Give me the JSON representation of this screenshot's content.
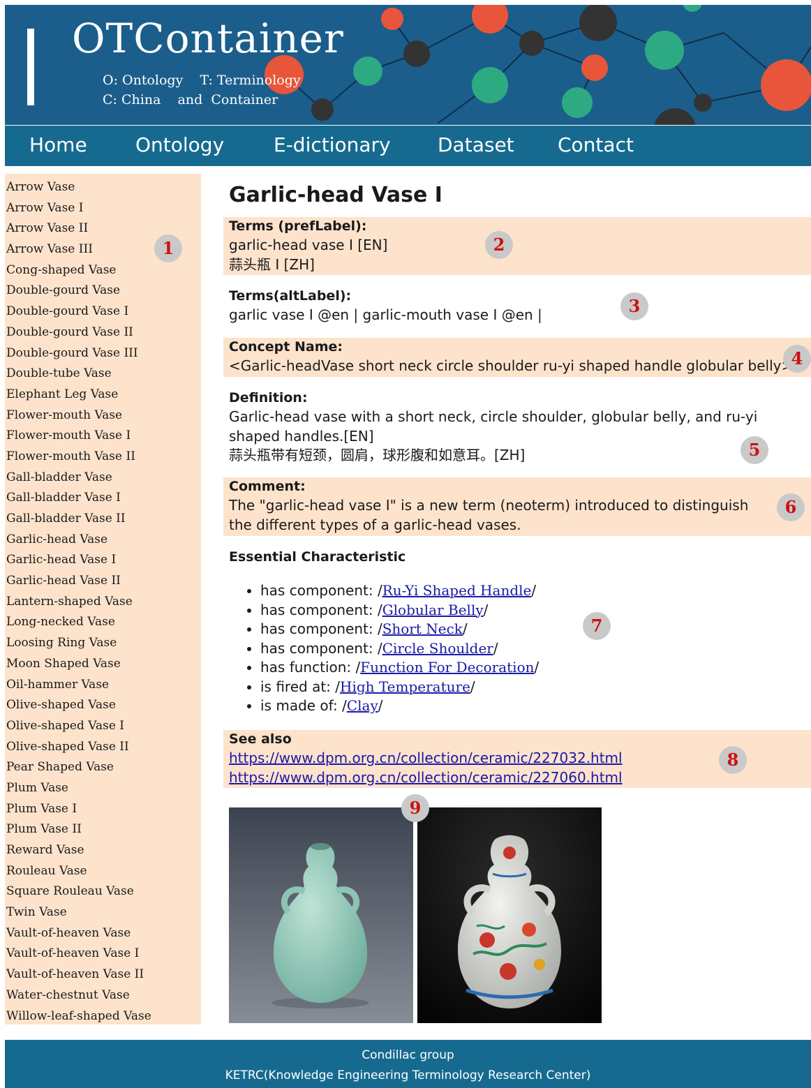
{
  "header": {
    "title": "OTContainer",
    "subtitle_line1": "O: Ontology    T: Terminology",
    "subtitle_line2": "C: China    and  Container",
    "colors": {
      "banner": "#1b5e8c",
      "node_red": "#e8553a",
      "node_green": "#2eaa83",
      "node_dark": "#333333"
    }
  },
  "nav": {
    "items": [
      "Home",
      "Ontology",
      "E-dictionary",
      "Dataset",
      "Contact"
    ],
    "color": "#176a8f"
  },
  "sidebar": {
    "items": [
      "Arrow Vase",
      "Arrow Vase I",
      "Arrow Vase II",
      "Arrow Vase III",
      "Cong-shaped Vase",
      "Double-gourd Vase",
      "Double-gourd Vase I",
      "Double-gourd Vase II",
      "Double-gourd Vase III",
      "Double-tube Vase",
      "Elephant Leg Vase",
      "Flower-mouth Vase",
      "Flower-mouth Vase I",
      "Flower-mouth Vase II",
      "Gall-bladder Vase",
      "Gall-bladder Vase I",
      "Gall-bladder Vase II",
      "Garlic-head Vase",
      "Garlic-head Vase I",
      "Garlic-head Vase II",
      "Lantern-shaped Vase",
      "Long-necked Vase",
      "Loosing Ring Vase",
      "Moon Shaped Vase",
      "Oil-hammer Vase",
      "Olive-shaped Vase",
      "Olive-shaped Vase I",
      "Olive-shaped Vase II",
      "Pear Shaped Vase",
      "Plum Vase",
      "Plum Vase I",
      "Plum Vase II",
      "Reward Vase",
      "Rouleau Vase",
      "Square Rouleau Vase",
      "Twin Vase",
      "Vault-of-heaven Vase",
      "Vault-of-heaven Vase I",
      "Vault-of-heaven Vase II",
      "Water-chestnut Vase",
      "Willow-leaf-shaped Vase"
    ],
    "color": "#fde3cc"
  },
  "markers": [
    "1",
    "2",
    "3",
    "4",
    "5",
    "6",
    "7",
    "8",
    "9"
  ],
  "main": {
    "title": "Garlic-head Vase I",
    "pref_label": {
      "label": "Terms (prefLabel):",
      "en": "garlic-head vase I [EN]",
      "zh": "蒜头瓶 I [ZH]"
    },
    "alt_label": {
      "label": "Terms(altLabel):",
      "value": "garlic vase I @en | garlic-mouth vase I @en |"
    },
    "concept": {
      "label": "Concept Name:",
      "value": "<Garlic-headVase short neck circle shoulder ru-yi shaped handle globular belly>"
    },
    "definition": {
      "label": "Definition:",
      "en": "Garlic-head vase with a short neck, circle shoulder, globular belly, and ru-yi shaped handles.[EN]",
      "zh": "蒜头瓶带有短颈，圆肩，球形腹和如意耳。[ZH]"
    },
    "comment": {
      "label": "Comment:",
      "value": "The \"garlic-head vase I\" is a new term (neoterm) introduced to distinguish the different types of a garlic-head vases."
    },
    "essential": {
      "label": "Essential Characteristic",
      "items": [
        {
          "prefix": "has component: /",
          "link": "Ru-Yi Shaped Handle",
          "suffix": "/"
        },
        {
          "prefix": "has component: /",
          "link": "Globular Belly",
          "suffix": "/"
        },
        {
          "prefix": "has component: /",
          "link": "Short Neck",
          "suffix": "/"
        },
        {
          "prefix": "has component: /",
          "link": "Circle Shoulder",
          "suffix": "/"
        },
        {
          "prefix": "has function: /",
          "link": "Function For Decoration",
          "suffix": "/"
        },
        {
          "prefix": "is fired at: /",
          "link": "High Temperature",
          "suffix": "/"
        },
        {
          "prefix": "is made of: /",
          "link": "Clay",
          "suffix": "/"
        }
      ]
    },
    "see_also": {
      "label": "See also",
      "links": [
        "https://www.dpm.org.cn/collection/ceramic/227032.html",
        "https://www.dpm.org.cn/collection/ceramic/227060.html"
      ]
    }
  },
  "footer": {
    "line1": "Condillac group",
    "line2": "KETRC(Knowledge Engineering Terminology Research Center)"
  }
}
